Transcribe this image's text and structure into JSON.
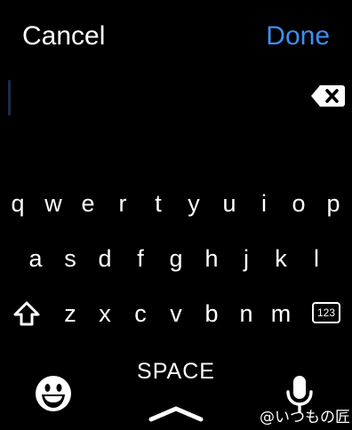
{
  "header": {
    "cancel_label": "Cancel",
    "done_label": "Done",
    "done_color": "#3d8ef2"
  },
  "text_field": {
    "value": "",
    "delete_icon": "delete-left-icon"
  },
  "keyboard": {
    "row1": [
      "q",
      "w",
      "e",
      "r",
      "t",
      "y",
      "u",
      "i",
      "o",
      "p"
    ],
    "row2": [
      "a",
      "s",
      "d",
      "f",
      "g",
      "h",
      "j",
      "k",
      "l"
    ],
    "row3": [
      "z",
      "x",
      "c",
      "v",
      "b",
      "n",
      "m"
    ],
    "shift_icon": "shift-arrow-icon",
    "numbers_label": "123",
    "space_label": "SPACE",
    "emoji_icon": "emoji-face-icon",
    "dismiss_icon": "chevron-up-icon",
    "mic_icon": "microphone-icon"
  },
  "watermark": "@いつもの匠"
}
